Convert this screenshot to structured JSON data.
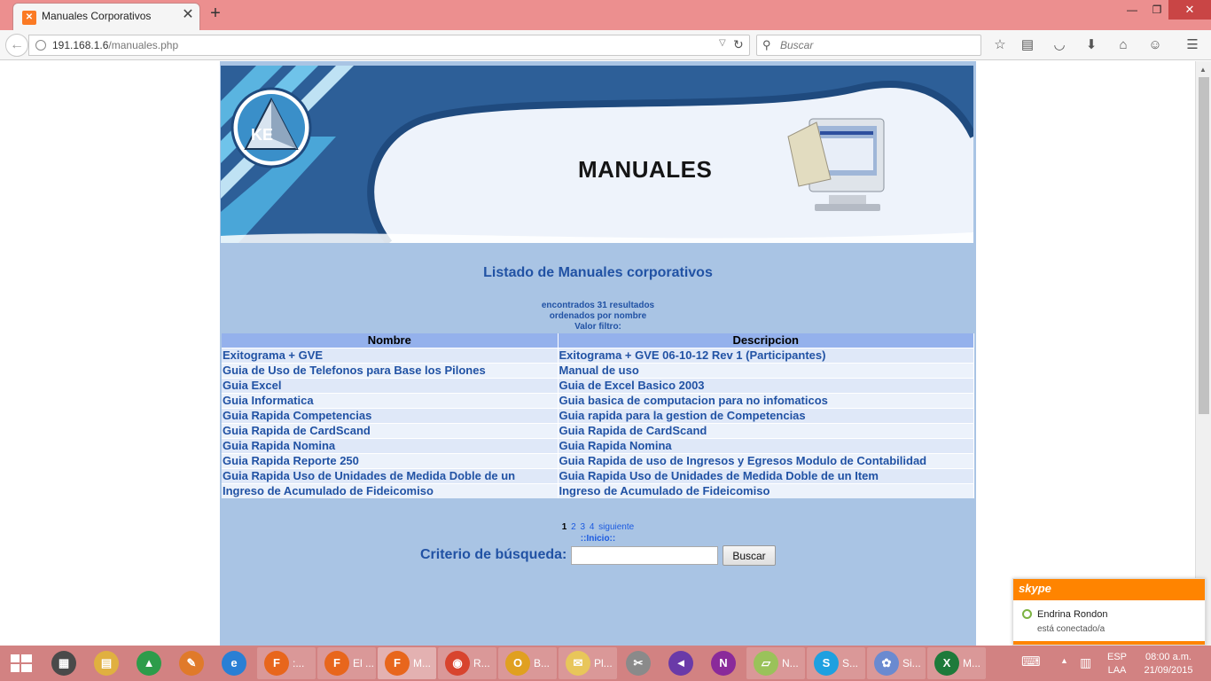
{
  "browser": {
    "tab_title": "Manuales Corporativos",
    "favicon_glyph": "✕",
    "url_host": "191.168.1.6",
    "url_path": "/manuales.php",
    "search_placeholder": "Buscar",
    "toolbar_icons": [
      "bookmark-star-icon",
      "reading-list-icon",
      "pocket-icon",
      "downloads-icon",
      "home-icon",
      "hello-icon",
      "menu-icon"
    ]
  },
  "banner": {
    "title": "MANUALES"
  },
  "listing": {
    "title": "Listado de Manuales corporativos",
    "found": "encontrados 31 resultados",
    "order": "ordenados por nombre",
    "filter": "Valor filtro:",
    "columns": [
      "Nombre",
      "Descripcion"
    ],
    "rows": [
      [
        "Exitograma + GVE",
        "Exitograma + GVE 06-10-12 Rev 1 (Participantes)"
      ],
      [
        "Guia de Uso de Telefonos para Base los Pilones",
        "Manual de uso"
      ],
      [
        "Guia Excel",
        "Guia de Excel Basico 2003"
      ],
      [
        "Guia Informatica",
        "Guia basica de computacion para no infomaticos"
      ],
      [
        "Guia Rapida Competencias",
        "Guia rapida para la gestion de Competencias"
      ],
      [
        "Guia Rapida de CardScand",
        "Guia Rapida de CardScand"
      ],
      [
        "Guia Rapida Nomina",
        "Guia Rapida Nomina"
      ],
      [
        "Guia Rapida Reporte 250",
        "Guia Rapida de uso de Ingresos y Egresos Modulo de Contabilidad"
      ],
      [
        "Guia Rapida Uso de Unidades de Medida Doble de un",
        "Guia Rapida Uso de Unidades de Medida Doble de un Item"
      ],
      [
        "Ingreso de Acumulado de Fideicomiso",
        "Ingreso de Acumulado de Fideicomiso"
      ]
    ]
  },
  "pager": {
    "current": "1",
    "pages": [
      "2",
      "3",
      "4"
    ],
    "next": "siguiente",
    "home": "::Inicio::"
  },
  "search": {
    "label": "Criterio de búsqueda:",
    "value": "",
    "button": "Buscar"
  },
  "skype": {
    "brand": "skype",
    "contact": "Endrina Rondon",
    "message": "está conectado/a"
  },
  "taskbar": {
    "items": [
      {
        "name": "chrome-apps",
        "label": "",
        "glyph": "▦",
        "color": "#4a4a4a",
        "state": ""
      },
      {
        "name": "file-explorer",
        "label": "",
        "glyph": "▤",
        "color": "#e0b040",
        "state": ""
      },
      {
        "name": "google-drive",
        "label": "",
        "glyph": "▲",
        "color": "#2d9c4a",
        "state": ""
      },
      {
        "name": "app-badge",
        "label": "",
        "glyph": "✎",
        "color": "#e07a2a",
        "state": ""
      },
      {
        "name": "internet-explorer",
        "label": "",
        "glyph": "e",
        "color": "#2a7fd4",
        "state": ""
      },
      {
        "name": "firefox-1",
        "label": ":...",
        "glyph": "F",
        "color": "#e8661c",
        "state": "open"
      },
      {
        "name": "firefox-2",
        "label": "El ...",
        "glyph": "F",
        "color": "#e8661c",
        "state": "open"
      },
      {
        "name": "firefox-3",
        "label": "M...",
        "glyph": "F",
        "color": "#e8661c",
        "state": "active"
      },
      {
        "name": "chrome",
        "label": "R...",
        "glyph": "◉",
        "color": "#d8442e",
        "state": "open"
      },
      {
        "name": "outlook",
        "label": "B...",
        "glyph": "O",
        "color": "#e0a020",
        "state": "open"
      },
      {
        "name": "mail",
        "label": "Pl...",
        "glyph": "✉",
        "color": "#e8c65a",
        "state": "open"
      },
      {
        "name": "tools",
        "label": "",
        "glyph": "✂",
        "color": "#8a8a8a",
        "state": ""
      },
      {
        "name": "visual-studio",
        "label": "",
        "glyph": "◄",
        "color": "#6a3aa8",
        "state": ""
      },
      {
        "name": "onenote",
        "label": "",
        "glyph": "N",
        "color": "#8a2a9a",
        "state": ""
      },
      {
        "name": "sticky-notes",
        "label": "N...",
        "glyph": "▱",
        "color": "#9ac25a",
        "state": "open"
      },
      {
        "name": "skype",
        "label": "S...",
        "glyph": "S",
        "color": "#1ea0e0",
        "state": "open"
      },
      {
        "name": "paint",
        "label": "Si...",
        "glyph": "✿",
        "color": "#6a8ad0",
        "state": "open"
      },
      {
        "name": "excel",
        "label": "M...",
        "glyph": "X",
        "color": "#1e7a3a",
        "state": "open"
      }
    ],
    "lang": "ESP",
    "layout": "LAA",
    "time": "08:00 a.m.",
    "date": "21/09/2015"
  }
}
